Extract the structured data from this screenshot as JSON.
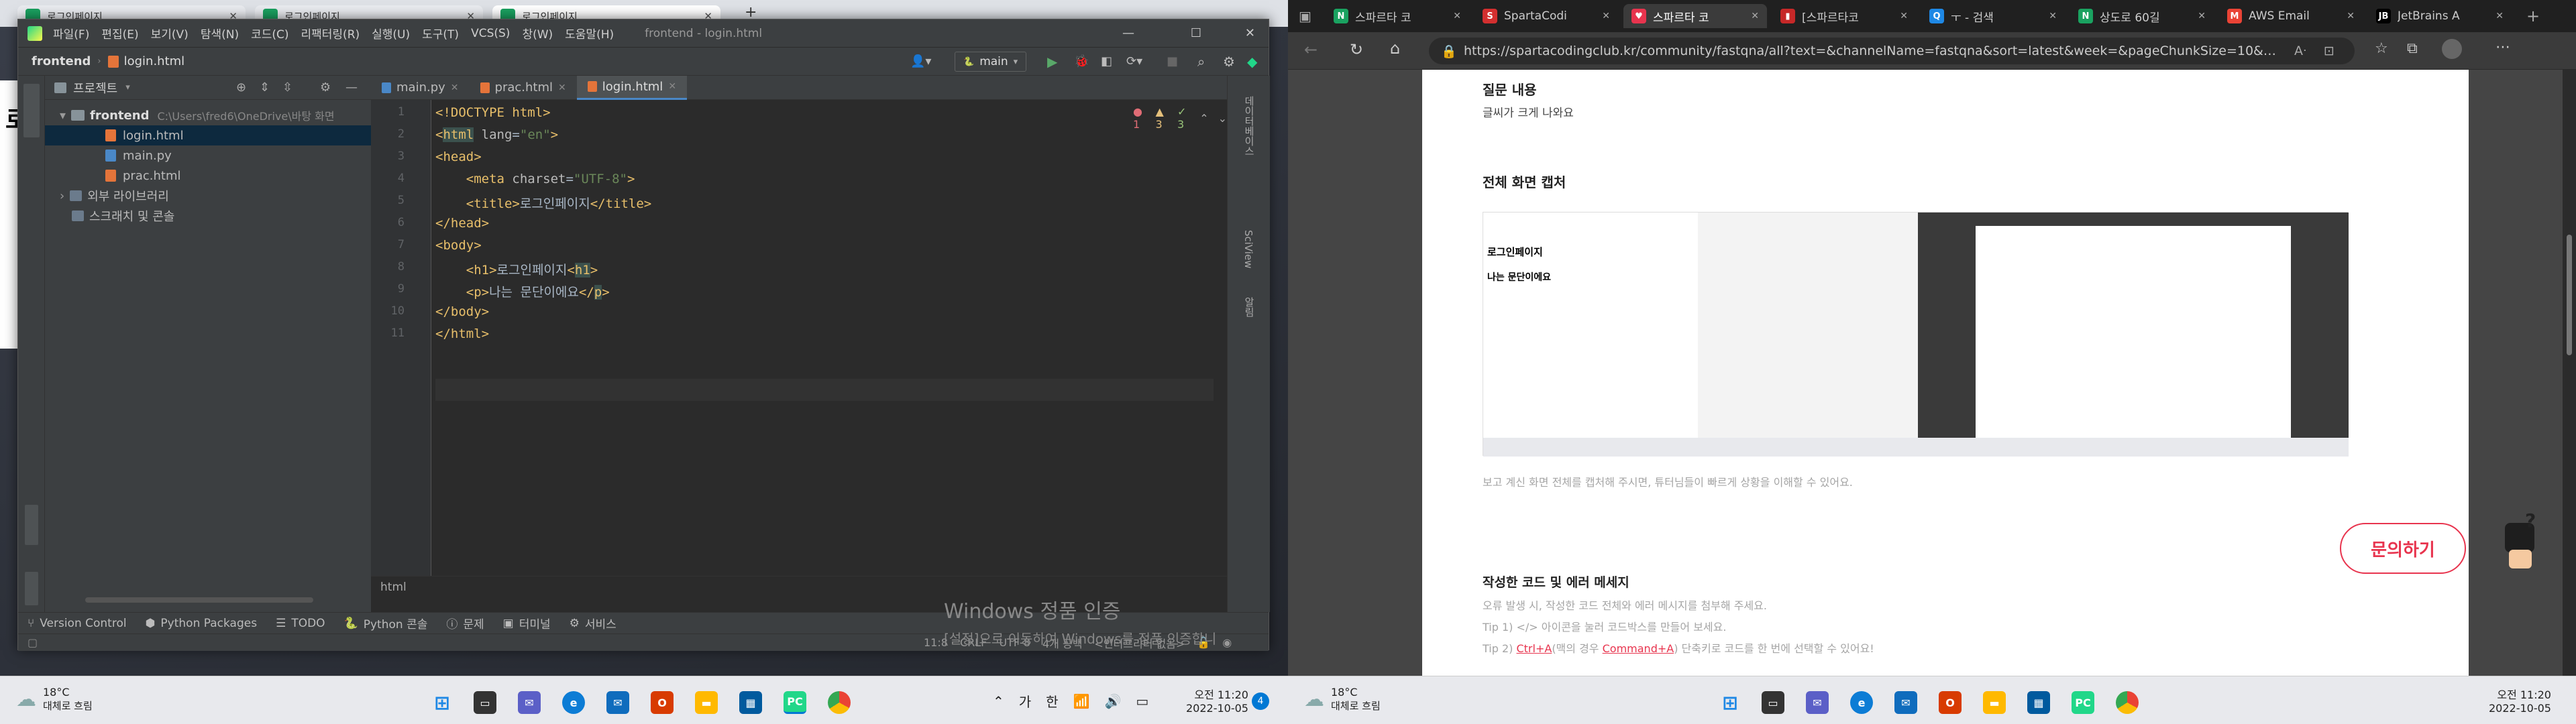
{
  "left": {
    "bg_browser": {
      "tabs": [
        "로그인페이지",
        "로그인페이지",
        "로그인페이지"
      ],
      "partial_text": "로"
    },
    "pycharm": {
      "menu": [
        "파일(F)",
        "편집(E)",
        "보기(V)",
        "탐색(N)",
        "코드(C)",
        "리팩터링(R)",
        "실행(U)",
        "도구(T)",
        "VCS(S)",
        "창(W)",
        "도움말(H)"
      ],
      "window_title": "frontend - login.html",
      "nav": {
        "project": "frontend",
        "file": "login.html",
        "branch": "main"
      },
      "project_panel": {
        "title": "프로젝트",
        "root": "frontend",
        "root_path": "C:\\Users\\fred6\\OneDrive\\바탕 화면",
        "files": [
          "login.html",
          "main.py",
          "prac.html"
        ],
        "ext_libs": "외부 라이브러리",
        "scratches": "스크래치 및 콘솔"
      },
      "tabs": [
        {
          "label": "main.py"
        },
        {
          "label": "prac.html"
        },
        {
          "label": "login.html",
          "active": true
        }
      ],
      "inspections": {
        "errors": "1",
        "warnings": "3",
        "weak": "3"
      },
      "code_lines": [
        [
          {
            "t": "<!DOCTYPE html>",
            "c": "tag"
          }
        ],
        [
          {
            "t": "<",
            "c": "tag"
          },
          {
            "t": "html",
            "c": "tag hl"
          },
          {
            "t": " lang",
            "c": "attr"
          },
          {
            "t": "=",
            "c": "txt"
          },
          {
            "t": "\"en\"",
            "c": "str"
          },
          {
            "t": ">",
            "c": "tag"
          }
        ],
        [
          {
            "t": "<head>",
            "c": "tag"
          }
        ],
        [
          {
            "t": "    <meta ",
            "c": "tag"
          },
          {
            "t": "charset",
            "c": "attr"
          },
          {
            "t": "=",
            "c": "txt"
          },
          {
            "t": "\"UTF-8\"",
            "c": "str"
          },
          {
            "t": ">",
            "c": "tag"
          }
        ],
        [
          {
            "t": "    <title>",
            "c": "tag"
          },
          {
            "t": "로그인페이지",
            "c": "txt"
          },
          {
            "t": "</title>",
            "c": "tag"
          }
        ],
        [
          {
            "t": "</head>",
            "c": "tag"
          }
        ],
        [
          {
            "t": "<body>",
            "c": "tag"
          }
        ],
        [
          {
            "t": "    <h1>",
            "c": "tag"
          },
          {
            "t": "로그인페이지",
            "c": "txt"
          },
          {
            "t": "<",
            "c": "tag"
          },
          {
            "t": "h1",
            "c": "tag hl"
          },
          {
            "t": ">",
            "c": "tag"
          }
        ],
        [
          {
            "t": "    <p>",
            "c": "tag"
          },
          {
            "t": "나는 ",
            "c": "txt"
          },
          {
            "t": "문단이에요",
            "c": "txt"
          },
          {
            "t": "</",
            "c": "tag"
          },
          {
            "t": "p",
            "c": "tag hl"
          },
          {
            "t": ">",
            "c": "tag"
          }
        ],
        [
          {
            "t": "</body>",
            "c": "tag"
          }
        ],
        [
          {
            "t": "</html>",
            "c": "tag"
          }
        ]
      ],
      "line_numbers": [
        "1",
        "2",
        "3",
        "4",
        "5",
        "6",
        "7",
        "8",
        "9",
        "10",
        "11"
      ],
      "breadcrumb": "html",
      "right_strip": [
        "데이터베이스",
        "SciView",
        "알림"
      ],
      "tool_windows": [
        "Version Control",
        "Python Packages",
        "TODO",
        "Python 콘솔",
        "문제",
        "터미널",
        "서비스"
      ],
      "status": {
        "pos": "11:8",
        "eol": "CRLF",
        "enc": "UTF-8",
        "indent": "4개 공백",
        "interp": "<인터프리터 없음>"
      },
      "win_activation": {
        "line1": "Windows 정품 인증",
        "line2": "[설정]으로 이동하여 Windows를 정품 인증합니"
      }
    },
    "taskbar": {
      "temp": "18°C",
      "weather": "대체로 흐림",
      "time": "오전 11:20",
      "date": "2022-10-05",
      "notif": "4",
      "ime1": "가",
      "ime2": "한"
    }
  },
  "right": {
    "tabs": [
      {
        "label": "스파르타 코",
        "fav": "#1aa260",
        "g": "N"
      },
      {
        "label": "SpartaCodi",
        "fav": "#d32f2f",
        "g": "S"
      },
      {
        "label": "스파르타 코",
        "fav": "#e8344e",
        "g": "♥",
        "active": true
      },
      {
        "label": "[스파르타코",
        "fav": "#c62828",
        "g": "▮"
      },
      {
        "label": "ㅜ - 검색",
        "fav": "#1e88e5",
        "g": "Q"
      },
      {
        "label": "상도로 60길",
        "fav": "#1aa260",
        "g": "N"
      },
      {
        "label": "AWS Email",
        "fav": "#ea4335",
        "g": "M"
      },
      {
        "label": "JetBrains A",
        "fav": "#000000",
        "g": "JB"
      }
    ],
    "url": "https://spartacodingclub.kr/community/fastqna/all?text=&channelName=fastqna&sort=latest&week=&pageChunkSize=10&curP...",
    "page": {
      "q_title": "질문 내용",
      "q_body": "글씨가 크게 나와요",
      "shot_title": "전체 화면 캡처",
      "shot_desc": "보고 계신 화면 전체를 캡처해 주시면, 튜터님들이 빠르게 상황을 이해할 수 있어요.",
      "code_title": "작성한 코드 및 에러 메세지",
      "code_desc": "오류 발생 시, 작성한 코드 전체와 에러 메시지를 첨부해 주세요.",
      "tip1": "Tip 1) </> 아이콘을 눌러 코드박스를 만들어 보세요.",
      "tip2_pre": "Tip 2) ",
      "tip2_link1": "Ctrl+A",
      "tip2_mid": "(맥의 경우 ",
      "tip2_link2": "Command+A",
      "tip2_post": ") 단축키로 코드를 한 번에 선택할 수 있어요!",
      "ask_button": "문의하기",
      "inner_h1": "로그인페이지",
      "inner_p": "나는 문단이에요"
    },
    "taskbar": {
      "temp": "18°C",
      "weather": "대체로 흐림",
      "time": "오전 11:20",
      "date": "2022-10-05"
    }
  }
}
